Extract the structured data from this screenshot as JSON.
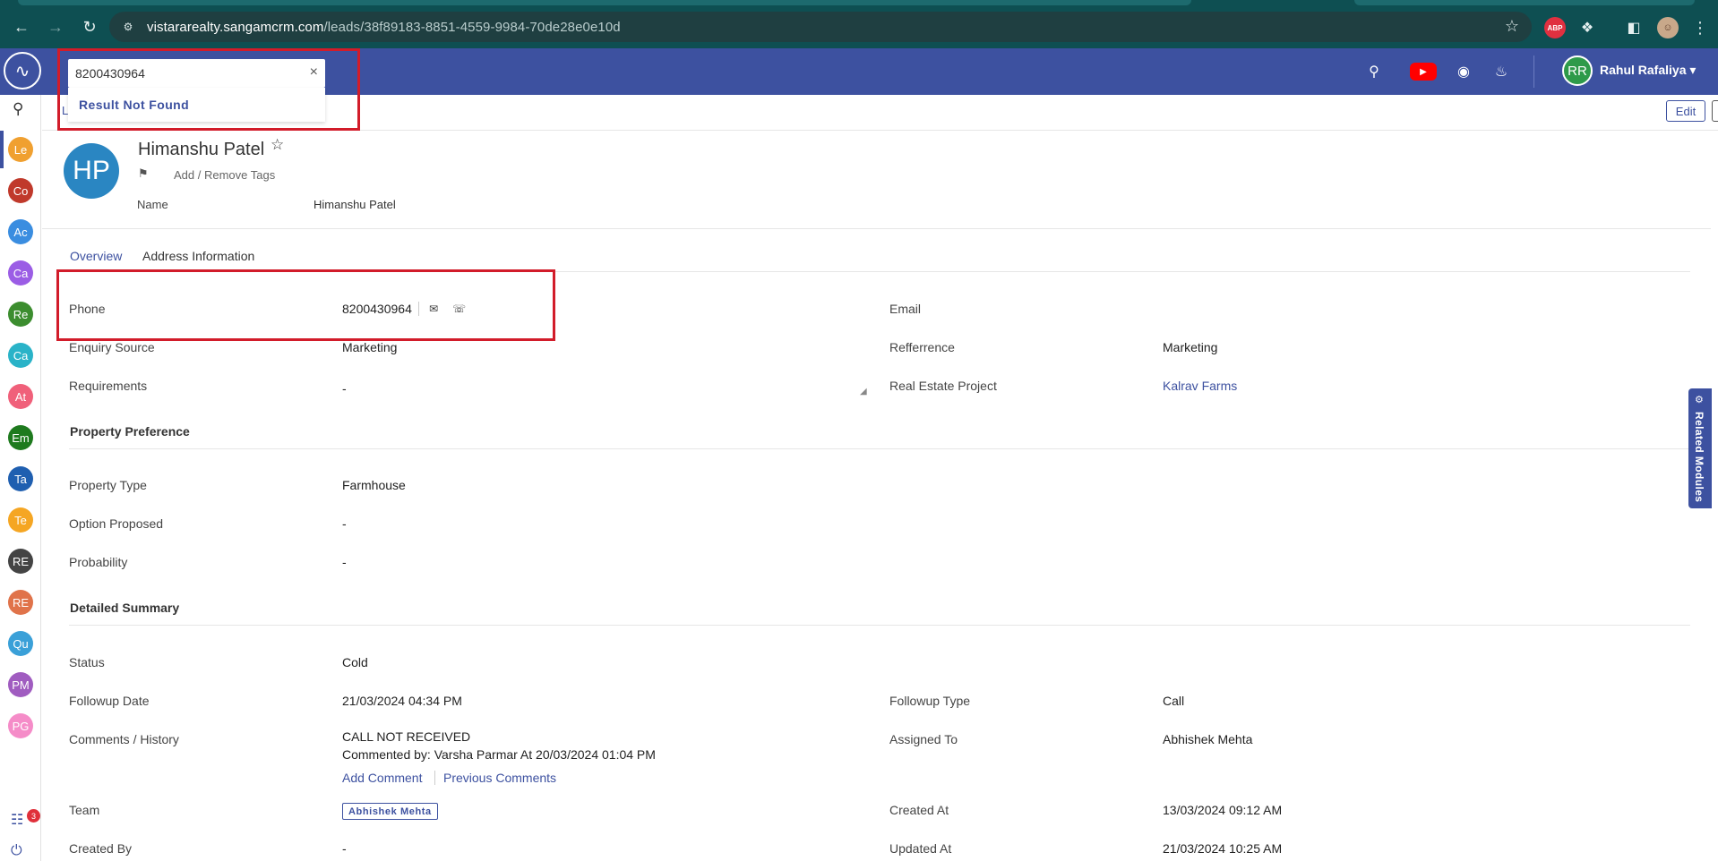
{
  "browser": {
    "url_host": "vistararealty.sangamcrm.com",
    "url_path": "/leads/38f89183-8851-4559-9984-70de28e0e10d",
    "ext_abp": "ABP"
  },
  "header": {
    "user_initials": "RR",
    "user_name": "Rahul Rafaliya"
  },
  "search": {
    "value": "8200430964",
    "result": "Result Not Found"
  },
  "rail": {
    "modules": [
      {
        "abbr": "Le",
        "color": "#f0a030"
      },
      {
        "abbr": "Co",
        "color": "#c0392b"
      },
      {
        "abbr": "Ac",
        "color": "#3a8de0"
      },
      {
        "abbr": "Ca",
        "color": "#9b5de5"
      },
      {
        "abbr": "Re",
        "color": "#3c8d2f"
      },
      {
        "abbr": "Ca",
        "color": "#2ab3c8"
      },
      {
        "abbr": "At",
        "color": "#f0607a"
      },
      {
        "abbr": "Em",
        "color": "#1e7a1e"
      },
      {
        "abbr": "Ta",
        "color": "#1f5fb0"
      },
      {
        "abbr": "Te",
        "color": "#f5a623"
      },
      {
        "abbr": "RE",
        "color": "#444444"
      },
      {
        "abbr": "RE",
        "color": "#e0734a"
      },
      {
        "abbr": "Qu",
        "color": "#3aa0d8"
      },
      {
        "abbr": "PM",
        "color": "#a05cc0"
      },
      {
        "abbr": "PG",
        "color": "#f58cc8"
      }
    ],
    "badge": "3"
  },
  "toolbar": {
    "edit_label": "Edit",
    "more_label": "•••"
  },
  "profile": {
    "initials": "HP",
    "name": "Himanshu Patel",
    "tags_label": "Add / Remove Tags",
    "name_label": "Name",
    "name_value": "Himanshu Patel"
  },
  "tabs": [
    "Overview",
    "Address Information"
  ],
  "overview": {
    "phone_label": "Phone",
    "phone_value": "8200430964",
    "email_label": "Email",
    "enquiry_label": "Enquiry Source",
    "enquiry_value": "Marketing",
    "reference_label": "Refferrence",
    "reference_value": "Marketing",
    "requirements_label": "Requirements",
    "requirements_value": "-",
    "project_label": "Real Estate Project",
    "project_value": "Kalrav Farms"
  },
  "property": {
    "title": "Property Preference",
    "type_label": "Property Type",
    "type_value": "Farmhouse",
    "option_label": "Option Proposed",
    "option_value": "-",
    "probability_label": "Probability",
    "probability_value": "-"
  },
  "summary": {
    "title": "Detailed Summary",
    "status_label": "Status",
    "status_value": "Cold",
    "followup_date_label": "Followup Date",
    "followup_date_value": "21/03/2024 04:34 PM",
    "followup_type_label": "Followup Type",
    "followup_type_value": "Call",
    "comments_label": "Comments / History",
    "comment_text": "CALL NOT RECEIVED",
    "comment_by": "Commented by: Varsha Parmar At 20/03/2024 01:04 PM",
    "add_comment": "Add Comment",
    "previous_comments": "Previous Comments",
    "assigned_label": "Assigned To",
    "assigned_value": "Abhishek Mehta",
    "team_label": "Team",
    "team_value": "Abhishek Mehta",
    "created_at_label": "Created At",
    "created_at_value": "13/03/2024 09:12 AM",
    "created_by_label": "Created By",
    "created_by_value": "-",
    "updated_at_label": "Updated At",
    "updated_at_value": "21/03/2024 10:25 AM"
  },
  "related_modules": "Related Modules"
}
